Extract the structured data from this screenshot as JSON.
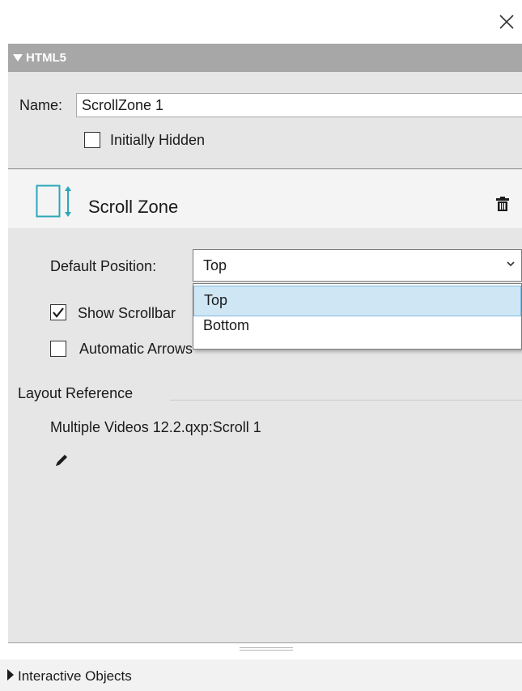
{
  "dialog": {
    "close_icon": "close-icon"
  },
  "panel": {
    "header_title": "HTML5",
    "name_label": "Name:",
    "name_value": "ScrollZone 1",
    "initially_hidden_label": "Initially Hidden",
    "initially_hidden_checked": false
  },
  "scroll_zone": {
    "icon": "scroll-zone-icon",
    "title": "Scroll Zone",
    "delete_icon": "trash-icon"
  },
  "default_position": {
    "label": "Default Position:",
    "selected": "Top",
    "options": [
      "Top",
      "Bottom"
    ]
  },
  "show_scrollbar": {
    "label": "Show Scrollbar",
    "checked": true
  },
  "automatic_arrows": {
    "label": "Automatic Arrows",
    "checked": false
  },
  "layout_reference": {
    "label": "Layout Reference",
    "value": "Multiple Videos 12.2.qxp:Scroll 1",
    "edit_icon": "pencil-icon"
  },
  "footer": {
    "interactive_objects_label": "Interactive Objects"
  },
  "colors": {
    "header_bg": "#a7a7a7",
    "panel_bg": "#e6e6e6",
    "accent": "#2aa8b8",
    "selection": "#cfe6f5"
  }
}
